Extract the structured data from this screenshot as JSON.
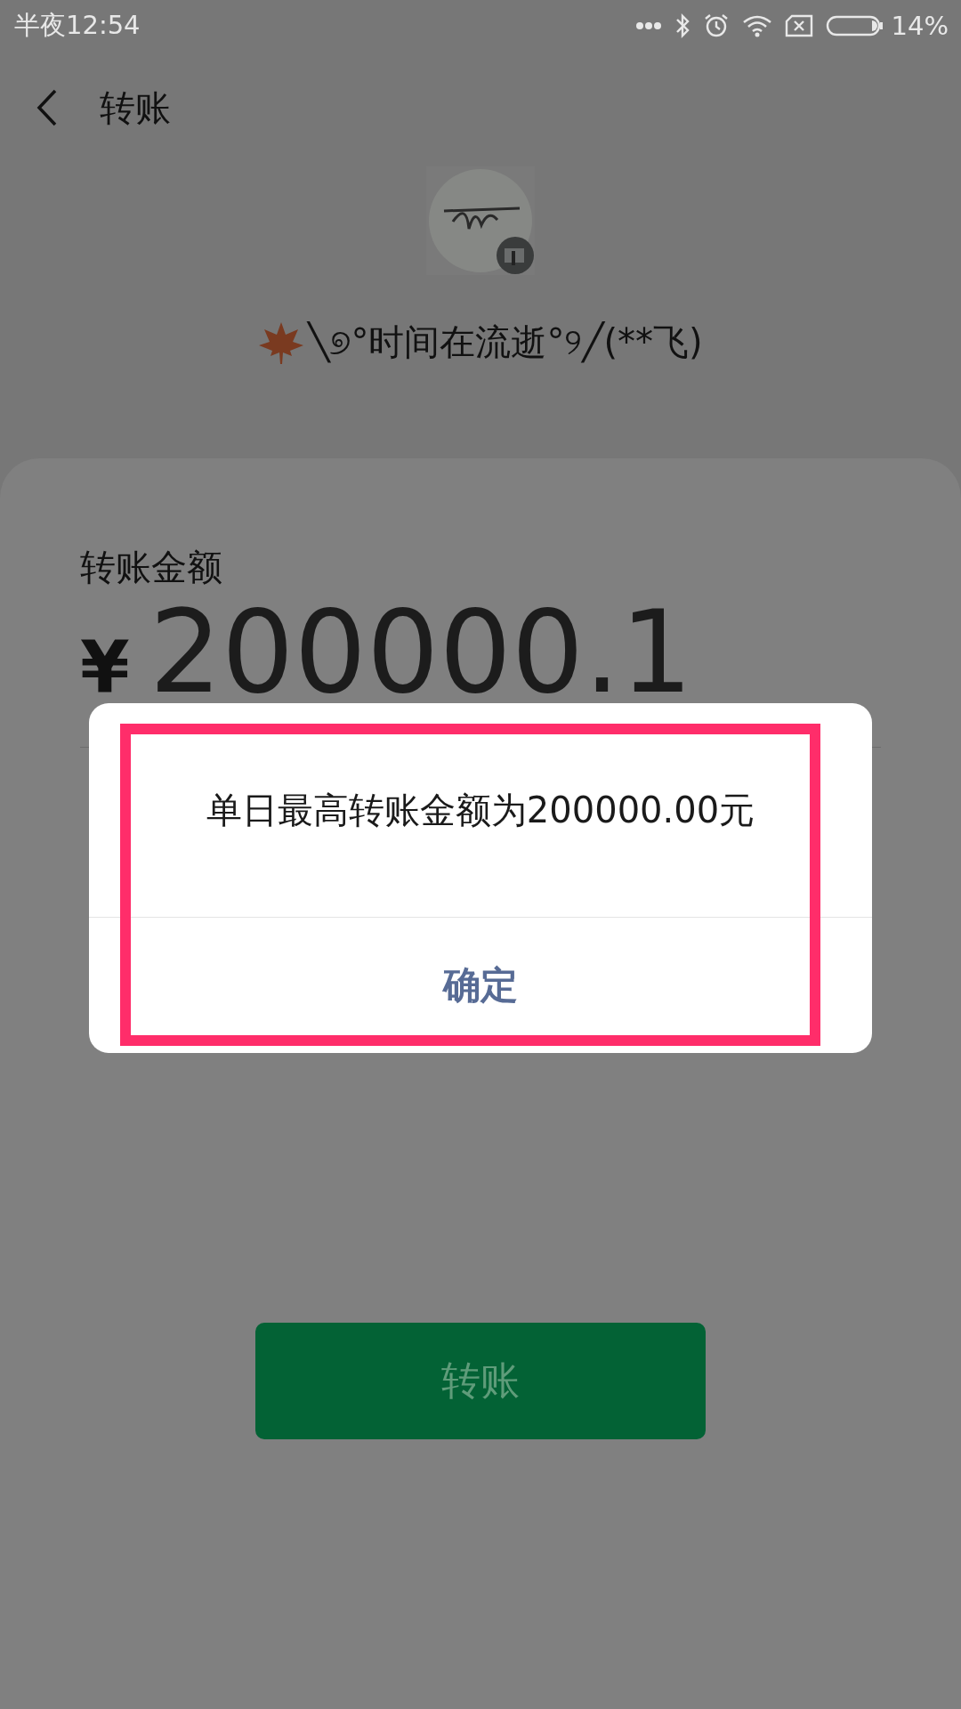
{
  "status_bar": {
    "time": "半夜12:54",
    "battery": "14%"
  },
  "header": {
    "title": "转账"
  },
  "payee": {
    "name": "╲୭°时间在流逝°୨╱(**飞)"
  },
  "amount": {
    "label": "转账金额",
    "currency": "¥",
    "value": "200000.1"
  },
  "transfer_button": {
    "label": "转账",
    "disabled": true
  },
  "dialog": {
    "message": "单日最高转账金额为200000.00元",
    "confirm": "确定",
    "highlighted": true
  }
}
